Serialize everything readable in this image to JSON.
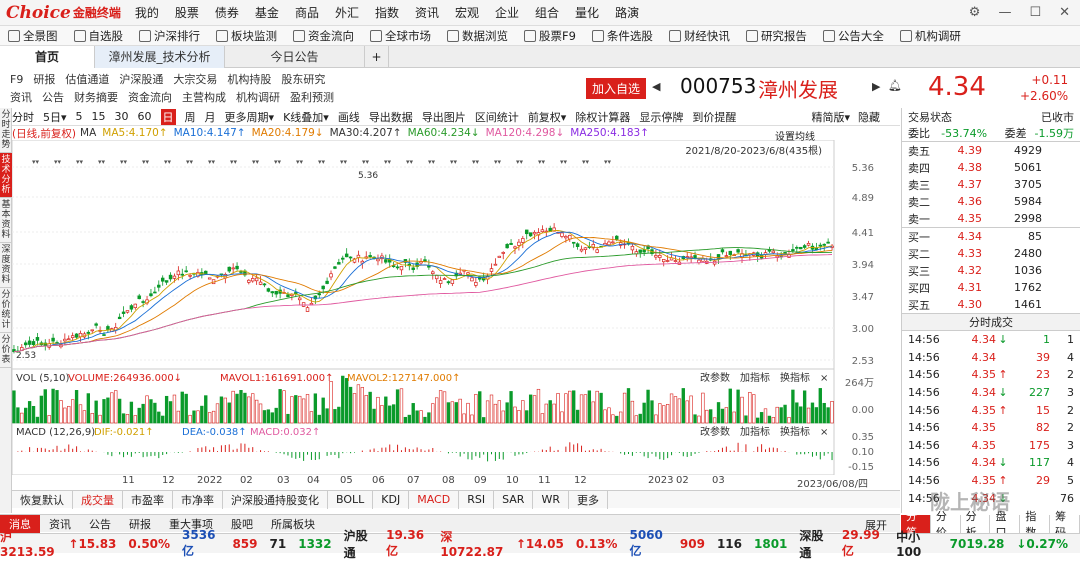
{
  "app": {
    "logo": "Choice",
    "logo_cn": "金融终端"
  },
  "menu": [
    "我的",
    "股票",
    "债券",
    "基金",
    "商品",
    "外汇",
    "指数",
    "资讯",
    "宏观",
    "企业",
    "组合",
    "量化",
    "路演"
  ],
  "toolbar": [
    "全景图",
    "自选股",
    "沪深排行",
    "板块监测",
    "资金流向",
    "全球市场",
    "数据浏览",
    "股票F9",
    "条件选股",
    "财经快讯",
    "研究报告",
    "公告大全",
    "机构调研"
  ],
  "tabs": {
    "home": "首页",
    "active": "漳州发展_技术分析",
    "other": "今日公告",
    "add": "+"
  },
  "links": {
    "row1": [
      "F9",
      "研报",
      "估值通道",
      "沪深股通",
      "大宗交易",
      "机构持股",
      "股东研究"
    ],
    "row2": [
      "资讯",
      "公告",
      "财务摘要",
      "资金流向",
      "主营构成",
      "机构调研",
      "盈利预测"
    ]
  },
  "stock": {
    "add_btn": "加入自选",
    "code": "000753",
    "name": "漳州发展",
    "price": "4.34",
    "change": "+0.11",
    "pct": "+2.60%"
  },
  "left_tabs": [
    {
      "label": "分时走势"
    },
    {
      "label": "技术分析",
      "on": true
    },
    {
      "label": "基本资料"
    },
    {
      "label": "深度资料"
    },
    {
      "label": "分价统计"
    },
    {
      "label": "分价表"
    }
  ],
  "periods": [
    "分时",
    "5日▾",
    "5",
    "15",
    "30",
    "60",
    "日",
    "周",
    "月",
    "更多周期▾",
    "K线叠加▾",
    "画线",
    "导出数据",
    "导出图片",
    "区间统计",
    "前复权▾",
    "除权计算器",
    "显示停牌",
    "到价提醒"
  ],
  "period_right": {
    "a": "精简版▾",
    "b": "隐藏"
  },
  "ma": {
    "title": "(日线,前复权)",
    "items": [
      {
        "t": "MA",
        "c": "#333"
      },
      {
        "t": "MA5:4.170↑",
        "c": "#d0a000"
      },
      {
        "t": "MA10:4.147↑",
        "c": "#1a6fd6"
      },
      {
        "t": "MA20:4.179↓",
        "c": "#e07b00"
      },
      {
        "t": "MA30:4.207↑",
        "c": "#333"
      },
      {
        "t": "MA60:4.234↓",
        "c": "#2a9a2a"
      },
      {
        "t": "MA120:4.298↓",
        "c": "#e05aa0"
      },
      {
        "t": "MA250:4.183↑",
        "c": "#8a2be2"
      }
    ]
  },
  "chart_labels": {
    "set_ma": "设置均线",
    "range": "2021/8/20-2023/6/8(435根)",
    "peak": "5.36",
    "low": "2.53"
  },
  "yticks": [
    "5.36",
    "4.89",
    "4.41",
    "3.94",
    "3.47",
    "3.00",
    "2.53"
  ],
  "vol": {
    "label": "VOL (5,10)",
    "v1": "VOLUME:264936.000↓",
    "v2": "MAVOL1:161691.000↑",
    "v3": "MAVOL2:127147.000↑",
    "btns": [
      "改参数",
      "加指标",
      "换指标",
      "×"
    ],
    "yticks": [
      "264万",
      "0.00"
    ]
  },
  "macd": {
    "label": "MACD (12,26,9)",
    "dif": "DIF:-0.021↑",
    "dea": "DEA:-0.038↑",
    "m": "MACD:0.032↑",
    "btns": [
      "改参数",
      "加指标",
      "换指标",
      "×"
    ],
    "yticks": [
      "0.35",
      "0.10",
      "-0.15"
    ]
  },
  "xaxis": [
    "11",
    "12",
    "2022",
    "02",
    "03",
    "04",
    "05",
    "06",
    "07",
    "08",
    "09",
    "10",
    "11",
    "12",
    "2023",
    "02",
    "03",
    "2023/06/08/四"
  ],
  "bottom_tabs": [
    "恢复默认",
    "成交量",
    "市盈率",
    "市净率",
    "沪深股通持股变化",
    "BOLL",
    "KDJ",
    "MACD",
    "RSI",
    "SAR",
    "WR",
    "更多"
  ],
  "news_tabs": [
    "消息",
    "资讯",
    "公告",
    "研报",
    "重大事项",
    "股吧",
    "所属板块"
  ],
  "right": {
    "status_label": "交易状态",
    "status": "已收市",
    "wb_label": "委比",
    "wb": "-53.74%",
    "wc_label": "委差",
    "wc": "-1.59万",
    "sell": [
      {
        "l": "卖五",
        "p": "4.39",
        "v": "4929"
      },
      {
        "l": "卖四",
        "p": "4.38",
        "v": "5061"
      },
      {
        "l": "卖三",
        "p": "4.37",
        "v": "3705"
      },
      {
        "l": "卖二",
        "p": "4.36",
        "v": "5984"
      },
      {
        "l": "卖一",
        "p": "4.35",
        "v": "2998"
      }
    ],
    "buy": [
      {
        "l": "买一",
        "p": "4.34",
        "v": "85"
      },
      {
        "l": "买二",
        "p": "4.33",
        "v": "2480"
      },
      {
        "l": "买三",
        "p": "4.32",
        "v": "1036"
      },
      {
        "l": "买四",
        "p": "4.31",
        "v": "1762"
      },
      {
        "l": "买五",
        "p": "4.30",
        "v": "1461"
      }
    ],
    "ticks_title": "分时成交",
    "ticks": [
      {
        "t": "14:56",
        "p": "4.34",
        "a": "↓",
        "v": "1",
        "n": "1"
      },
      {
        "t": "14:56",
        "p": "4.34",
        "a": "",
        "v": "39",
        "n": "4"
      },
      {
        "t": "14:56",
        "p": "4.35",
        "a": "↑",
        "v": "23",
        "n": "2"
      },
      {
        "t": "14:56",
        "p": "4.34",
        "a": "↓",
        "v": "227",
        "n": "3"
      },
      {
        "t": "14:56",
        "p": "4.35",
        "a": "↑",
        "v": "15",
        "n": "2"
      },
      {
        "t": "14:56",
        "p": "4.35",
        "a": "",
        "v": "82",
        "n": "2"
      },
      {
        "t": "14:56",
        "p": "4.35",
        "a": "",
        "v": "175",
        "n": "3"
      },
      {
        "t": "14:56",
        "p": "4.34",
        "a": "↓",
        "v": "117",
        "n": "4"
      },
      {
        "t": "14:56",
        "p": "4.35",
        "a": "↑",
        "v": "29",
        "n": "5"
      },
      {
        "t": "14:56",
        "p": "4.34",
        "a": "↓",
        "v": "",
        "n": "76"
      }
    ],
    "tabs": [
      "分笔",
      "分价",
      "分析",
      "盘口",
      "指数",
      "筹码"
    ],
    "expand": "展开"
  },
  "status": {
    "sh": "沪3213.59",
    "sh_c": "↑15.83",
    "sh_p": "0.50%",
    "sh_a": "3536亿",
    "n1": "859",
    "n2": "71",
    "n3": "1332",
    "hgt": "沪股通",
    "hgt_v": "19.36亿",
    "sz": "深10722.87",
    "sz_c": "↑14.05",
    "sz_p": "0.13%",
    "sz_a": "5060亿",
    "n4": "909",
    "n5": "116",
    "n6": "1801",
    "sgt": "深股通",
    "sgt_v": "29.99亿",
    "z": "中小100",
    "z_v": "7019.28",
    "z_c": "↓0.27%"
  },
  "watermark": "陇上秘语"
}
